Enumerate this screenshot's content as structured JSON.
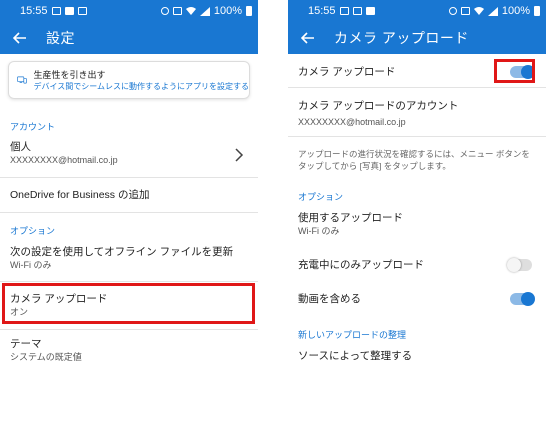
{
  "status": {
    "time": "15:55",
    "battery": "100%"
  },
  "left": {
    "title": "設定",
    "promo": {
      "title": "生産性を引き出す",
      "desc": "デバイス間でシームレスに動作するようにアプリを設定する"
    },
    "section_account": "アカウント",
    "account": {
      "title": "個人",
      "email": "XXXXXXXX@hotmail.co.jp"
    },
    "business": "OneDrive for Business の追加",
    "section_options": "オプション",
    "offline": {
      "title": "次の設定を使用してオフライン ファイルを更新",
      "sub": "Wi-Fi のみ"
    },
    "camera": {
      "title": "カメラ アップロード",
      "sub": "オン"
    },
    "theme": {
      "title": "テーマ",
      "sub": "システムの既定値"
    }
  },
  "right": {
    "title": "カメラ アップロード",
    "camera_upload": {
      "label": "カメラ アップロード",
      "on": true
    },
    "account": {
      "title": "カメラ アップロードのアカウント",
      "email": "XXXXXXXX@hotmail.co.jp"
    },
    "hint": "アップロードの進行状況を確認するには、メニュー ボタンをタップしてから [写真] をタップします。",
    "section_options": "オプション",
    "use_upload": {
      "title": "使用するアップロード",
      "sub": "Wi-Fi のみ"
    },
    "charging_only": {
      "label": "充電中にのみアップロード",
      "on": false
    },
    "include_video": {
      "label": "動画を含める",
      "on": true
    },
    "section_organize": "新しいアップロードの整理",
    "organize_by_source": "ソースによって整理する"
  },
  "colors": {
    "accent": "#1977d2",
    "highlight": "#e01717"
  }
}
